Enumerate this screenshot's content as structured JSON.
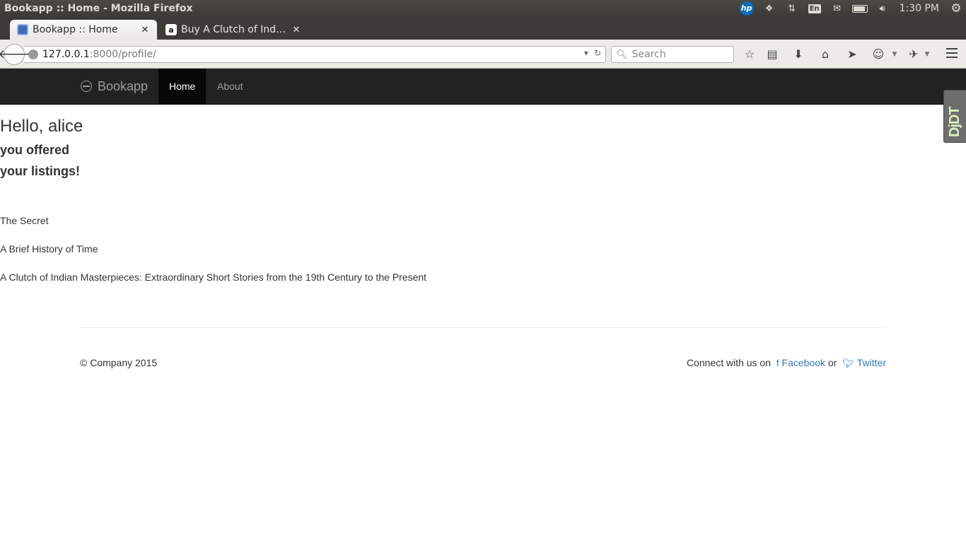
{
  "os": {
    "window_title": "Bookapp :: Home - Mozilla Firefox",
    "keyboard_layout": "En",
    "clock": "1:30 PM",
    "indicators": [
      "hp-icon",
      "dropbox-icon",
      "network-icon",
      "keyboard-icon",
      "mail-icon",
      "battery-icon",
      "volume-icon",
      "gear-icon"
    ]
  },
  "browser": {
    "tabs": [
      {
        "label": "Bookapp :: Home",
        "active": true
      },
      {
        "label": "Buy A Clutch of India…",
        "active": false
      }
    ],
    "url_host": "127.0.0.1",
    "url_rest": ":8000/profile/",
    "search_placeholder": "Search"
  },
  "site": {
    "brand": "Bookapp",
    "nav": {
      "home": "Home",
      "about": "About"
    },
    "ddt_label": "DjDT"
  },
  "profile": {
    "greeting": "Hello, alice",
    "offered_heading": "you offered",
    "listings_heading": "your listings!",
    "listings": [
      "The Secret",
      "A Brief History of Time",
      "A Clutch of Indian Masterpieces: Extraordinary Short Stories from the 19th Century to the Present"
    ]
  },
  "footer": {
    "copyright": "© Company 2015",
    "connect_text": "Connect with us on",
    "facebook": "Facebook",
    "or_text": "or",
    "twitter": "Twitter"
  },
  "colors": {
    "navbar_bg": "#222222",
    "navbar_active_bg": "#080808",
    "link": "#337ab7",
    "text": "#333333"
  }
}
